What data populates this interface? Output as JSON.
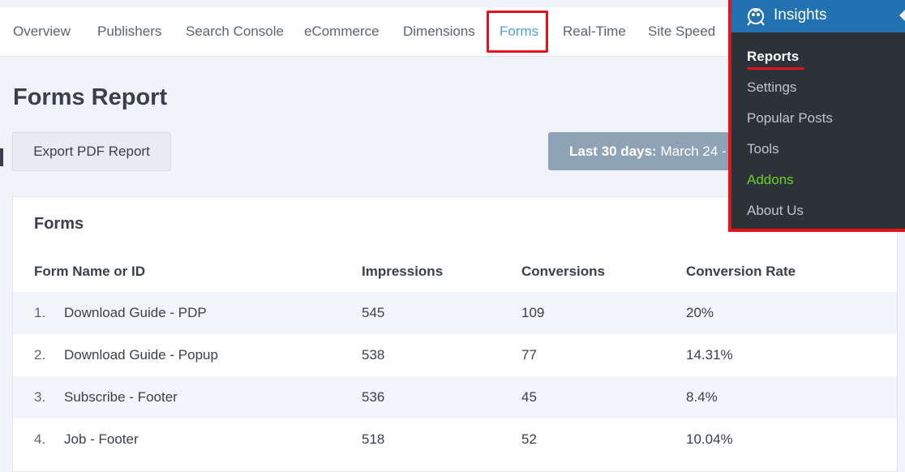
{
  "nav": {
    "tabs": [
      {
        "label": "Overview"
      },
      {
        "label": "Publishers"
      },
      {
        "label": "Search Console"
      },
      {
        "label": "eCommerce"
      },
      {
        "label": "Dimensions"
      },
      {
        "label": "Forms",
        "active": true
      },
      {
        "label": "Real-Time"
      },
      {
        "label": "Site Speed"
      }
    ]
  },
  "page": {
    "title": "Forms Report",
    "export_label": "Export PDF Report",
    "date_range_prefix": "Last 30 days:",
    "date_range_value": "March 24 -"
  },
  "card": {
    "title": "Forms",
    "columns": [
      "Form Name or ID",
      "Impressions",
      "Conversions",
      "Conversion Rate"
    ],
    "rows": [
      {
        "index": "1.",
        "name": "Download Guide - PDP",
        "impressions": "545",
        "conversions": "109",
        "rate": "20%"
      },
      {
        "index": "2.",
        "name": "Download Guide - Popup",
        "impressions": "538",
        "conversions": "77",
        "rate": "14.31%"
      },
      {
        "index": "3.",
        "name": "Subscribe - Footer",
        "impressions": "536",
        "conversions": "45",
        "rate": "8.4%"
      },
      {
        "index": "4.",
        "name": "Job - Footer",
        "impressions": "518",
        "conversions": "52",
        "rate": "10.04%"
      }
    ]
  },
  "sidebar": {
    "title": "Insights",
    "items": [
      {
        "label": "Reports",
        "current": true
      },
      {
        "label": "Settings"
      },
      {
        "label": "Popular Posts"
      },
      {
        "label": "Tools"
      },
      {
        "label": "Addons"
      },
      {
        "label": "About Us"
      }
    ]
  },
  "colors": {
    "accent": "#509fe2",
    "highlight": "#e4121c",
    "admin_bar": "#2271b1",
    "admin_bg": "#2c3338",
    "addons": "#6ccf2b"
  }
}
